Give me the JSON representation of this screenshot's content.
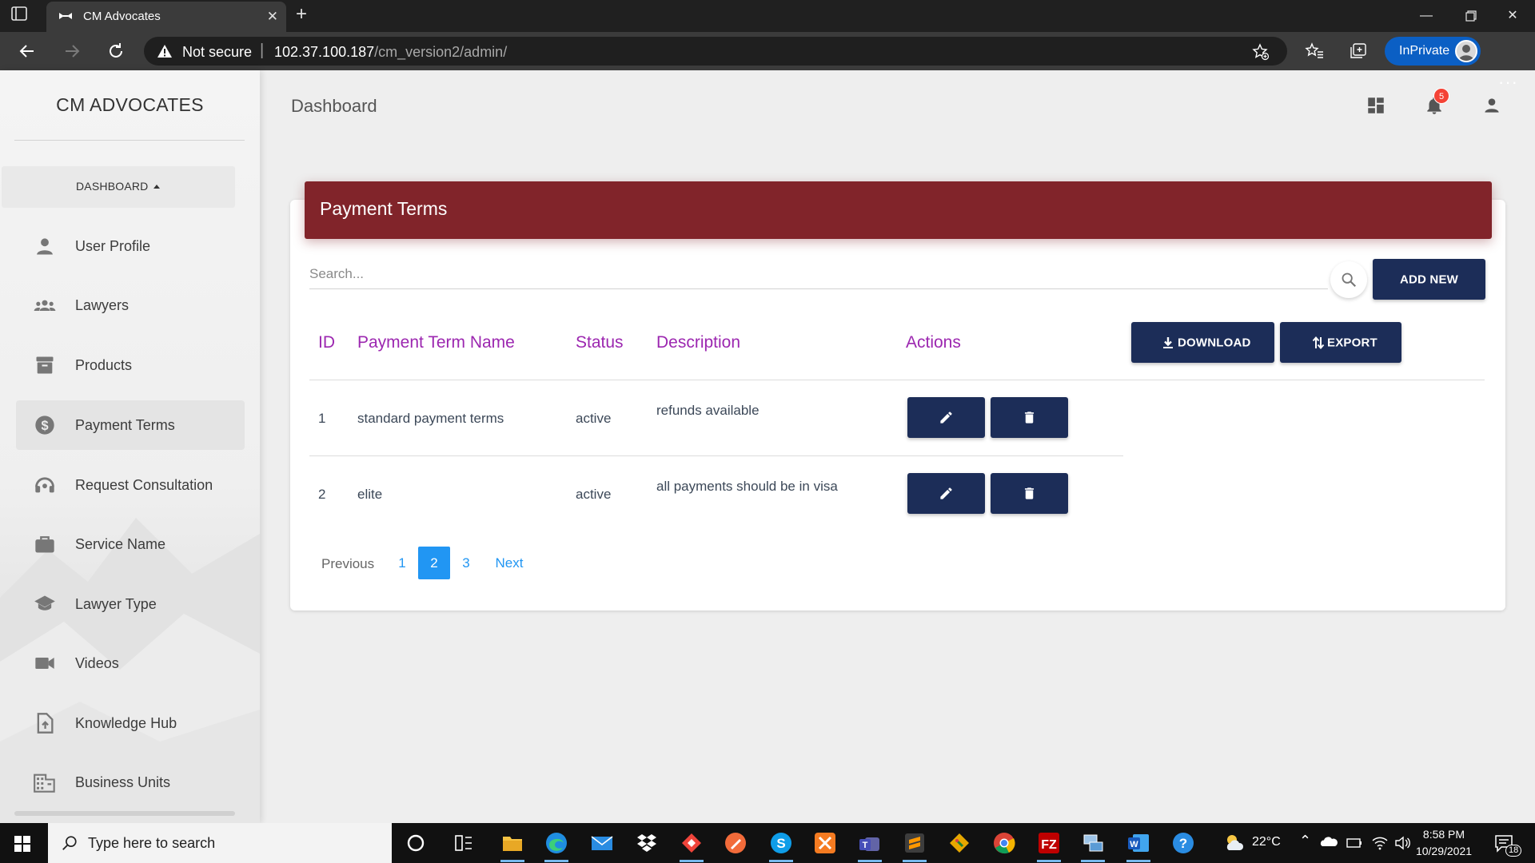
{
  "browser": {
    "tab_title": "CM Advocates",
    "security_label": "Not secure",
    "url_host": "102.37.100.187",
    "url_path": "/cm_version2/admin/",
    "inprivate_label": "InPrivate"
  },
  "sidebar": {
    "brand": "CM ADVOCATES",
    "dashboard_toggle": "DASHBOARD",
    "items": [
      {
        "label": "User Profile",
        "icon": "person-icon"
      },
      {
        "label": "Lawyers",
        "icon": "group-icon"
      },
      {
        "label": "Products",
        "icon": "archive-icon"
      },
      {
        "label": "Payment Terms",
        "icon": "dollar-icon",
        "active": true
      },
      {
        "label": "Request Consultation",
        "icon": "headset-icon"
      },
      {
        "label": "Service Name",
        "icon": "briefcase-icon"
      },
      {
        "label": "Lawyer Type",
        "icon": "school-icon"
      },
      {
        "label": "Videos",
        "icon": "videocam-icon"
      },
      {
        "label": "Knowledge Hub",
        "icon": "file-upload-icon"
      },
      {
        "label": "Business Units",
        "icon": "domain-icon"
      }
    ]
  },
  "header": {
    "title": "Dashboard",
    "notification_count": "5"
  },
  "card": {
    "title": "Payment Terms",
    "search_placeholder": "Search...",
    "add_new_label": "ADD NEW",
    "download_label": "DOWNLOAD",
    "export_label": "EXPORT",
    "columns": [
      "ID",
      "Payment Term Name",
      "Status",
      "Description",
      "Actions"
    ],
    "rows": [
      {
        "id": "1",
        "name": "standard payment terms",
        "status": "active",
        "description": "refunds available"
      },
      {
        "id": "2",
        "name": "elite",
        "status": "active",
        "description": "all payments should be in visa"
      }
    ]
  },
  "pagination": {
    "previous": "Previous",
    "pages": [
      "1",
      "2",
      "3"
    ],
    "current_page": "2",
    "next": "Next"
  },
  "taskbar": {
    "search_placeholder": "Type here to search",
    "temperature": "22°C",
    "time": "8:58 PM",
    "date": "10/29/2021",
    "notification_count": "18"
  },
  "colors": {
    "card_header": "#81242a",
    "button_primary": "#1c2d58",
    "table_header_text": "#9c27b0",
    "pagination_active": "#2196f3",
    "browser_accent": "#0b5fc4"
  }
}
